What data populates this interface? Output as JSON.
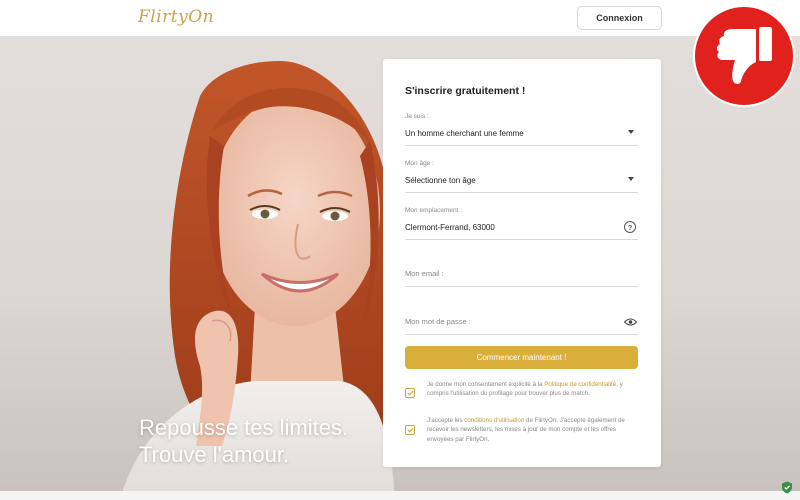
{
  "header": {
    "logo_text": "FlirtyOn",
    "login_label": "Connexion"
  },
  "hero": {
    "title_line1": "Repousse tes limites.",
    "title_line2": "Trouve l'amour."
  },
  "form": {
    "title": "S'inscrire gratuitement !",
    "iam": {
      "label": "Je suis :",
      "value": "Un homme cherchant une femme"
    },
    "age": {
      "label": "Mon âge :",
      "value": "Sélectionne ton âge"
    },
    "location": {
      "label": "Mon emplacement :",
      "value": "Clermont-Ferrand, 63000"
    },
    "email": {
      "placeholder": "Mon email :"
    },
    "password": {
      "placeholder": "Mon mot de passe :"
    },
    "submit_label": "Commencer maintenant !",
    "consent1": {
      "pre": "Je donne mon consentement explicite à la ",
      "link": "Politique de confidentialité",
      "post": ", y compris l'utilisation du profilage pour trouver plus de match."
    },
    "consent2": {
      "pre": "J'accepte les ",
      "link": "conditions d'utilisation",
      "post": " de FlirtyOn. J'accepte également de recevoir les newsletters, les mises à jour de mon compte et les offres envoyées par FlirtyOn."
    }
  },
  "badge": {
    "icon": "thumbs-down-icon",
    "color": "#e0211d"
  },
  "colors": {
    "accent": "#d9ae3b",
    "link": "#c79a26"
  }
}
